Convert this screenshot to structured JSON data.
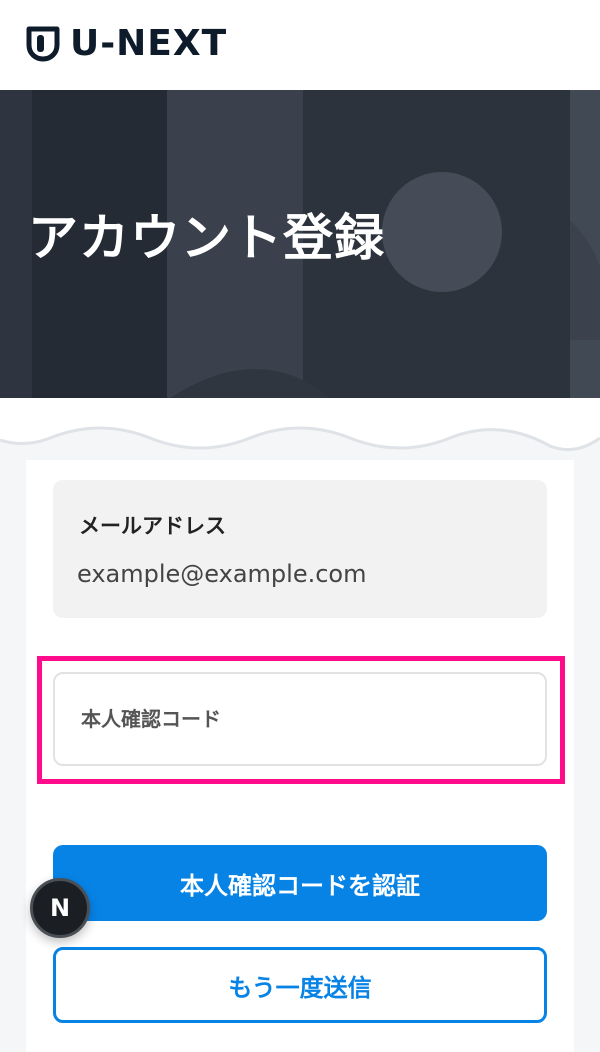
{
  "brand": {
    "name": "U-NEXT"
  },
  "hero": {
    "title": "アカウント登録"
  },
  "email": {
    "label": "メールアドレス",
    "value": "example@example.com"
  },
  "verification": {
    "placeholder": "本人確認コード"
  },
  "actions": {
    "verify_label": "本人確認コードを認証",
    "resend_label": "もう一度送信"
  },
  "dev_badge": {
    "letter": "N"
  },
  "colors": {
    "accent": "#0783e6",
    "highlight": "#ff0b8c",
    "hero_dark": "#2a3039"
  },
  "icons": {
    "logo": "shield-logo-icon"
  }
}
